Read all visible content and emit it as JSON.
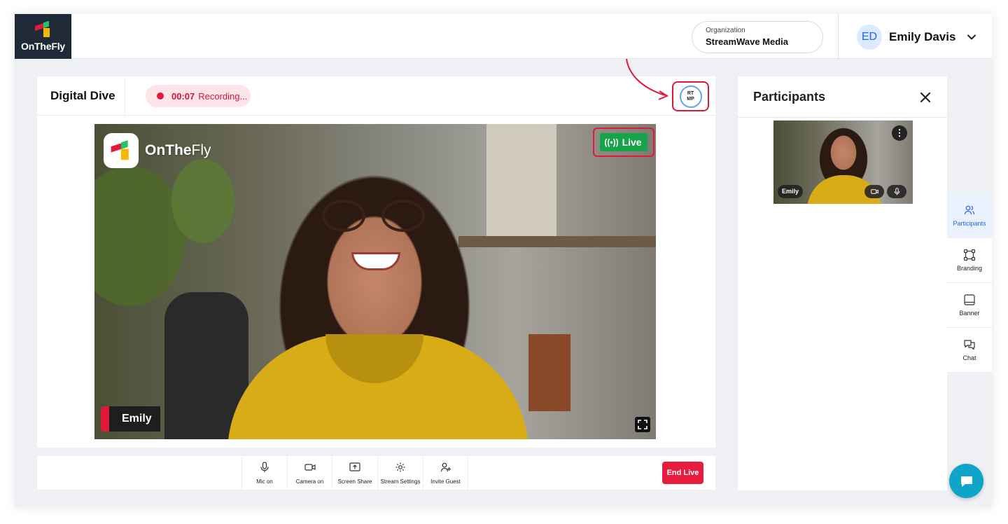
{
  "brand": {
    "name_bold": "OnTheFly",
    "name_regular": ""
  },
  "video_logo": {
    "bold": "OnThe",
    "regular": "Fly"
  },
  "organization": {
    "label": "Organization",
    "name": "StreamWave Media"
  },
  "user": {
    "initials": "ED",
    "name": "Emily Davis"
  },
  "stage": {
    "title": "Digital Dive",
    "recording": {
      "time": "00:07",
      "label": "Recording..."
    },
    "rtmp_label": "RTMP",
    "live_label": "Live",
    "speaker_name": "Emily"
  },
  "controls": [
    {
      "label": "Mic on",
      "icon": "mic-icon"
    },
    {
      "label": "Camera on",
      "icon": "camera-icon"
    },
    {
      "label": "Screen Share",
      "icon": "screen-share-icon"
    },
    {
      "label": "Stream Settings",
      "icon": "gear-icon"
    },
    {
      "label": "Invite Guest",
      "icon": "add-user-icon"
    }
  ],
  "end_live_label": "End Live",
  "participants_panel": {
    "title": "Participants",
    "participants": [
      {
        "name": "Emily"
      }
    ]
  },
  "rail": [
    {
      "label": "Participants",
      "icon": "participants-icon",
      "active": true
    },
    {
      "label": "Branding",
      "icon": "branding-icon",
      "active": false
    },
    {
      "label": "Banner",
      "icon": "banner-icon",
      "active": false
    },
    {
      "label": "Chat",
      "icon": "chat-icon",
      "active": false
    }
  ],
  "colors": {
    "accent_red": "#e0183a",
    "live_green": "#16a34a",
    "active_blue": "#2563eb",
    "logo_tile": "#1f2937",
    "chat_fab": "#0ea5c8"
  }
}
